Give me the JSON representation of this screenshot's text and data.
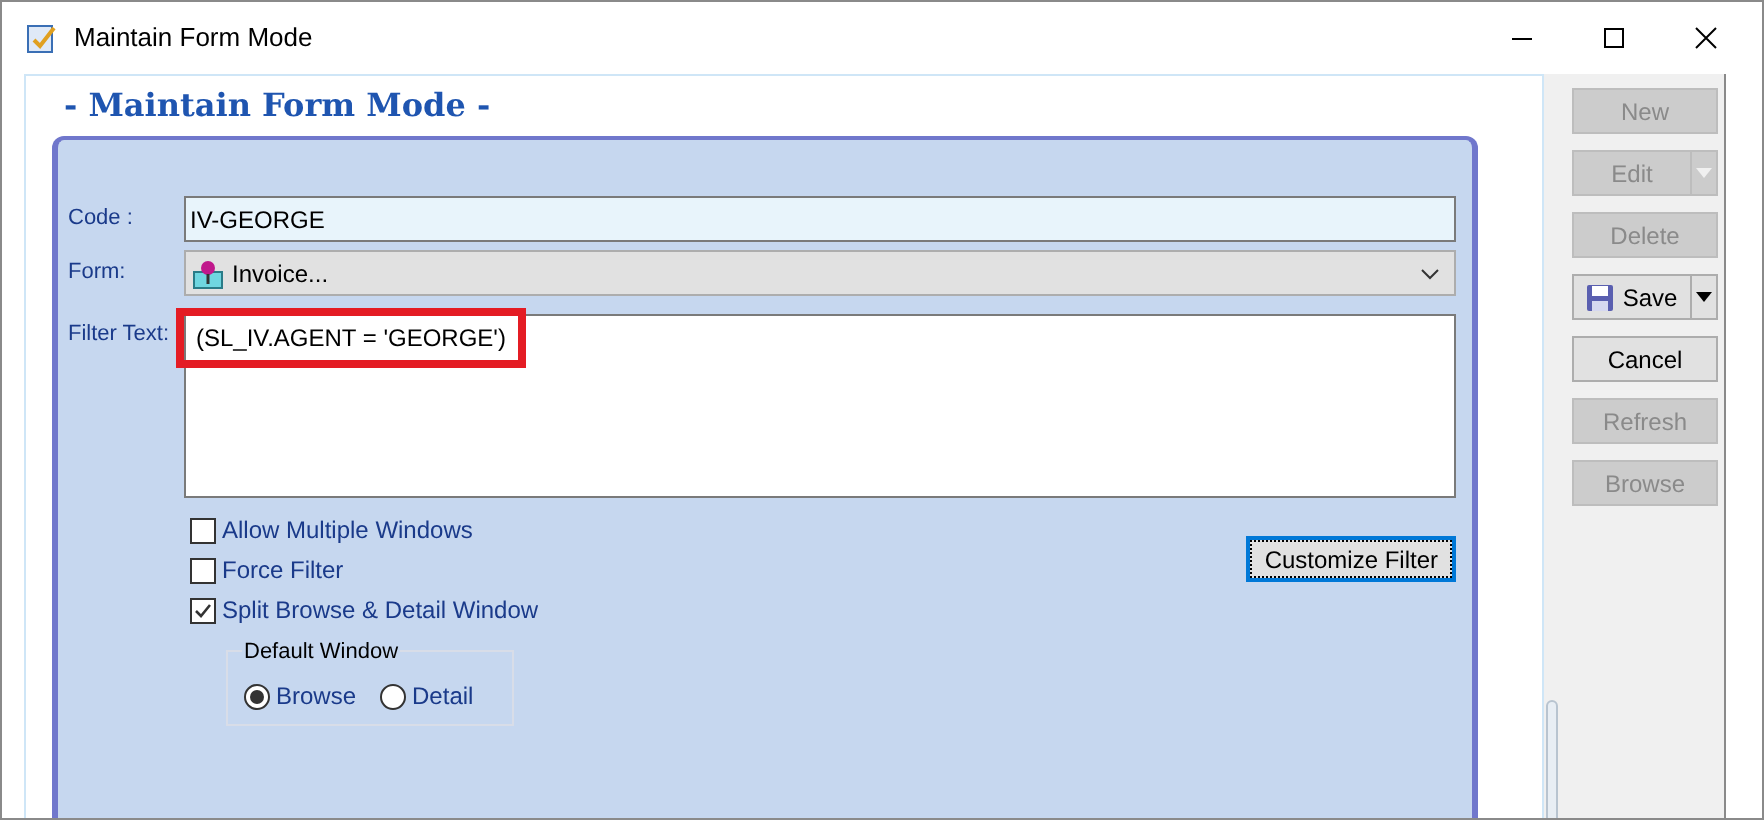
{
  "window": {
    "title": "Maintain Form Mode"
  },
  "heading": "- Maintain Form Mode -",
  "code": {
    "label": "Code :",
    "value": "IV-GEORGE"
  },
  "form": {
    "label": "Form:",
    "value": "Invoice..."
  },
  "filter": {
    "label": "Filter Text:",
    "value": "(SL_IV.AGENT = 'GEORGE')",
    "highlighted": true
  },
  "checkboxes": [
    {
      "label": "Allow Multiple Windows",
      "checked": false
    },
    {
      "label": "Force Filter",
      "checked": false
    },
    {
      "label": "Split Browse & Detail Window",
      "checked": true
    }
  ],
  "default_window": {
    "title": "Default Window",
    "options": [
      {
        "label": "Browse",
        "selected": true
      },
      {
        "label": "Detail",
        "selected": false
      }
    ]
  },
  "customize_button": "Customize Filter",
  "toolbar": [
    {
      "label": "New",
      "disabled": true,
      "kind": "plain"
    },
    {
      "label": "Edit",
      "disabled": true,
      "kind": "split"
    },
    {
      "label": "Delete",
      "disabled": true,
      "kind": "plain"
    },
    {
      "label": "Save",
      "disabled": false,
      "kind": "split-save"
    },
    {
      "label": "Cancel",
      "disabled": false,
      "kind": "plain"
    },
    {
      "label": "Refresh",
      "disabled": true,
      "kind": "plain"
    },
    {
      "label": "Browse",
      "disabled": true,
      "kind": "plain"
    }
  ]
}
